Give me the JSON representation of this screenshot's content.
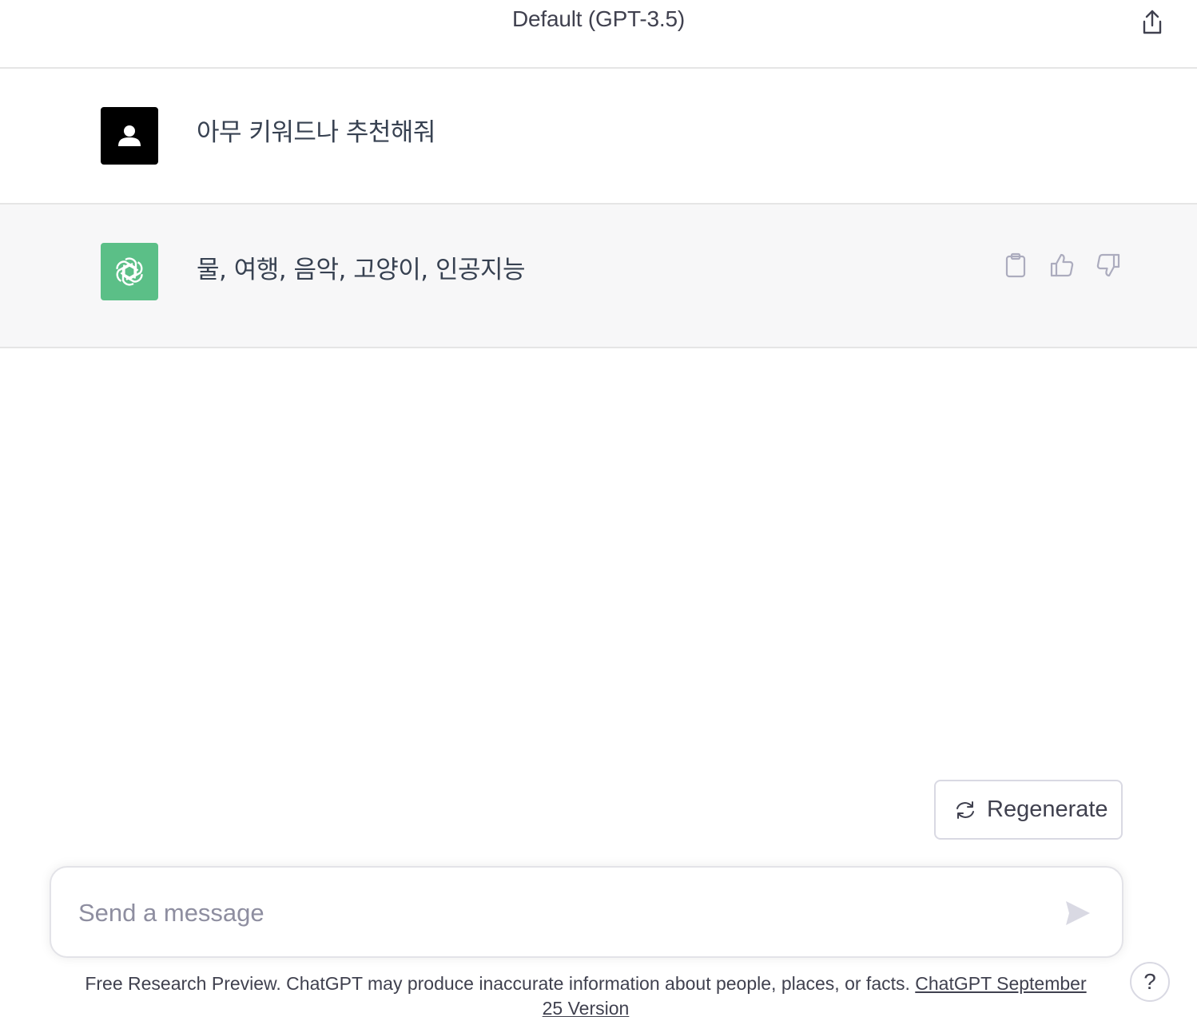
{
  "header": {
    "title": "Default (GPT-3.5)",
    "share_icon": "share-icon"
  },
  "conversation": {
    "user_message": "아무 키워드나 추천해줘",
    "assistant_message": "물, 여행, 음악, 고양이, 인공지능",
    "actions": [
      "copy-icon",
      "thumbs-up-icon",
      "thumbs-down-icon"
    ]
  },
  "regenerate": {
    "label": "Regenerate"
  },
  "composer": {
    "placeholder": "Send a message"
  },
  "footer": {
    "text": "Free Research Preview. ChatGPT may produce inaccurate information about people, places, or facts.",
    "link": "ChatGPT September 25 Version"
  },
  "help": {
    "label": "?"
  },
  "colors": {
    "assistant_avatar": "#5bbf87",
    "user_avatar": "#000000",
    "assistant_row_bg": "#f7f7f8"
  }
}
